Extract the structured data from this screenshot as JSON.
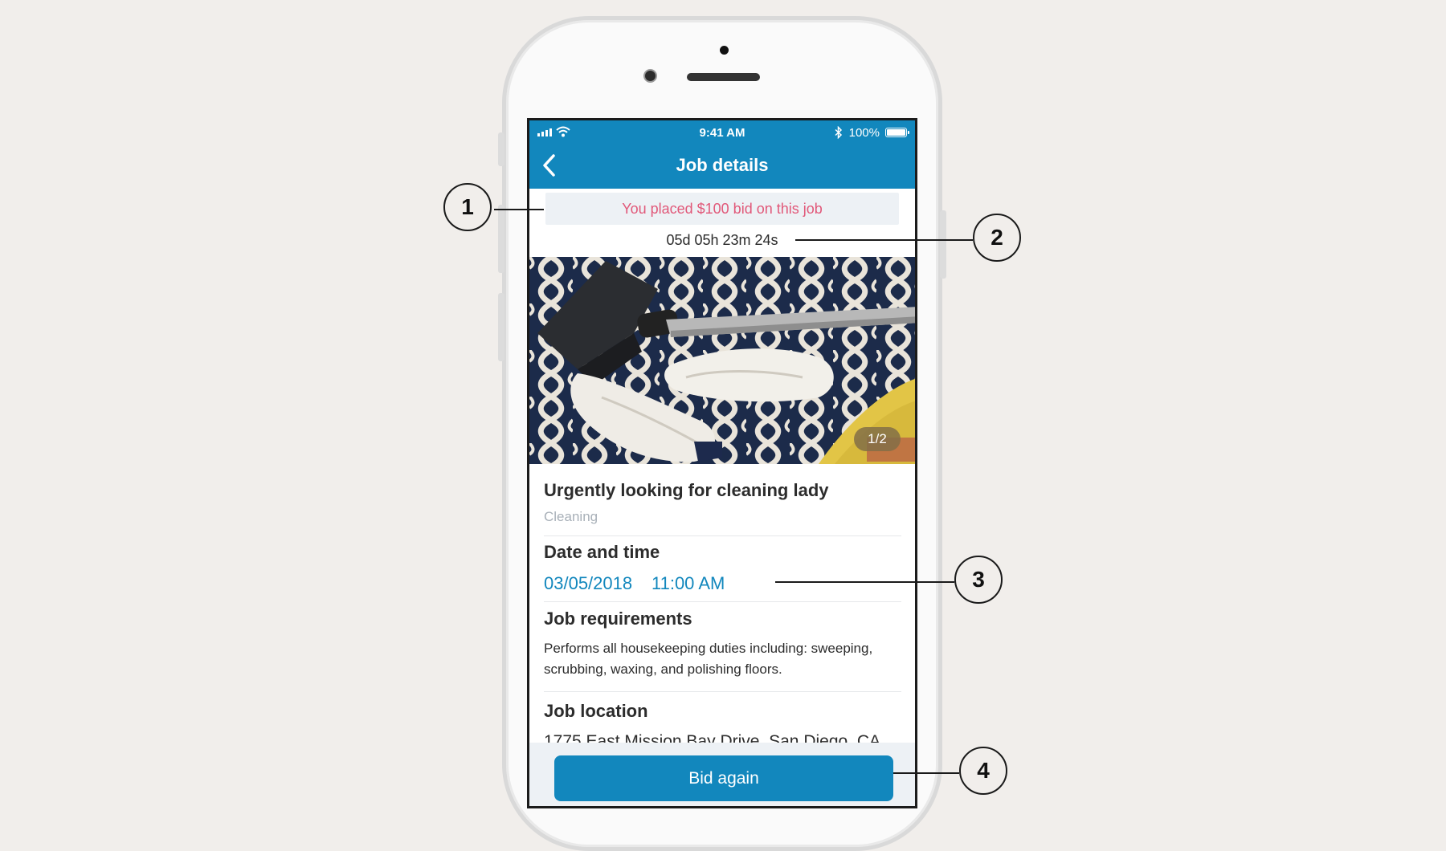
{
  "status_bar": {
    "time": "9:41 AM",
    "battery": "100%"
  },
  "header": {
    "title": "Job details",
    "back_icon": "chevron-left-icon"
  },
  "bid_banner": "You placed $100 bid on this job",
  "countdown": "05d 05h 23m 24s",
  "photo": {
    "pager": "1/2"
  },
  "job": {
    "title": "Urgently looking for cleaning lady",
    "category": "Cleaning"
  },
  "date_time": {
    "label": "Date and time",
    "date": "03/05/2018",
    "time": "11:00 AM"
  },
  "requirements": {
    "label": "Job requirements",
    "text": "Performs all housekeeping duties including: sweeping, scrubbing, waxing, and polishing floors."
  },
  "location": {
    "label": "Job location",
    "address": "1775 East Mission Bay Drive, San Diego, CA"
  },
  "footer": {
    "button_label": "Bid again"
  },
  "callouts": [
    "1",
    "2",
    "3",
    "4"
  ],
  "colors": {
    "brand": "#1287bd",
    "bid_text": "#e15879",
    "background": "#f1eeeb"
  }
}
